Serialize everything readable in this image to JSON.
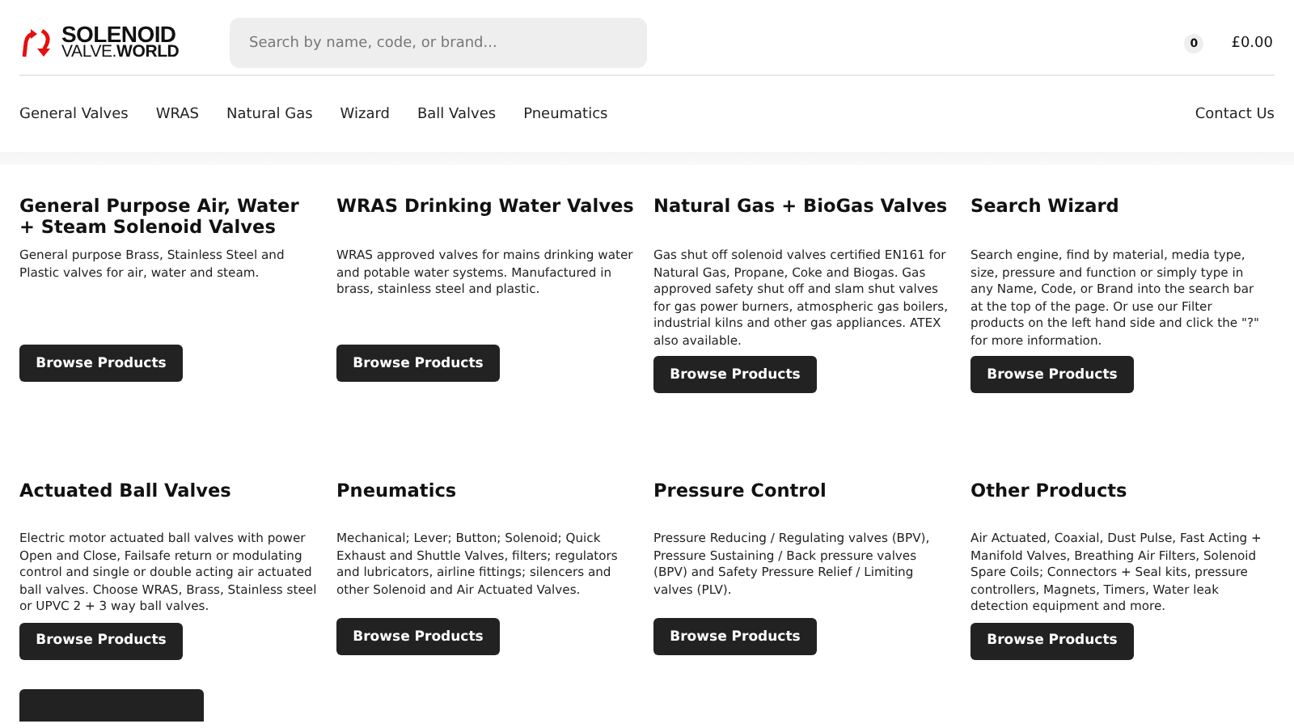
{
  "logo": {
    "line1": "SOLENOID",
    "line2": "VALVE.**WORLD**"
  },
  "search": {
    "placeholder": "Search by name, code, or brand..."
  },
  "cart": {
    "count": "0",
    "total": "£0.00"
  },
  "nav": {
    "items": [
      {
        "label": "General Valves"
      },
      {
        "label": "WRAS"
      },
      {
        "label": "Natural Gas"
      },
      {
        "label": "Wizard"
      },
      {
        "label": "Ball Valves"
      },
      {
        "label": "Pneumatics"
      }
    ],
    "contact": "Contact Us"
  },
  "categories": [
    {
      "title": "General Purpose Air, Water + Steam Solenoid Valves",
      "description": "General purpose Brass, Stainless Steel and Plastic valves for air, water and steam.",
      "button": "Browse Products"
    },
    {
      "title": "WRAS Drinking Water Valves",
      "description": "WRAS approved valves for mains drinking water and potable water systems. Manufactured in brass, stainless steel and plastic.",
      "button": "Browse Products"
    },
    {
      "title": "Natural Gas + BioGas Valves",
      "description": "Gas shut off solenoid valves certified EN161 for Natural Gas, Propane, Coke and Biogas. Gas approved safety shut off and slam shut valves for gas power burners, atmospheric gas boilers, industrial kilns and other gas appliances. ATEX also available.",
      "button": "Browse Products"
    },
    {
      "title": "Search Wizard",
      "description": "Search engine, find by material, media type, size, pressure and function or simply type in any Name, Code, or Brand into the search bar at the top of the page. Or use our Filter products on the left hand side and click the \"?\" for more information.",
      "button": "Browse Products"
    },
    {
      "title": "Actuated Ball Valves",
      "description": "Electric motor actuated ball valves with power Open and Close, Failsafe return or modulating control and single or double acting air actuated ball valves. Choose WRAS, Brass, Stainless steel or UPVC 2 + 3 way ball valves.",
      "button": "Browse Products"
    },
    {
      "title": "Pneumatics",
      "description": "Mechanical; Lever; Button; Solenoid; Quick Exhaust and Shuttle Valves, filters; regulators and lubricators, airline fittings; silencers and other Solenoid and Air Actuated Valves.",
      "button": "Browse Products"
    },
    {
      "title": "Pressure Control",
      "description": "Pressure Reducing / Regulating valves (BPV), Pressure Sustaining / Back pressure valves (BPV) and Safety Pressure Relief / Limiting valves (PLV).",
      "button": "Browse Products"
    },
    {
      "title": "Other Products",
      "description": "Air Actuated, Coaxial, Dust Pulse, Fast Acting + Manifold Valves, Breathing Air Filters, Solenoid Spare Coils; Connectors + Seal kits, pressure controllers, Magnets, Timers, Water leak detection equipment and more.",
      "button": "Browse Products"
    }
  ],
  "cut_off_button": {
    "visible": true
  }
}
